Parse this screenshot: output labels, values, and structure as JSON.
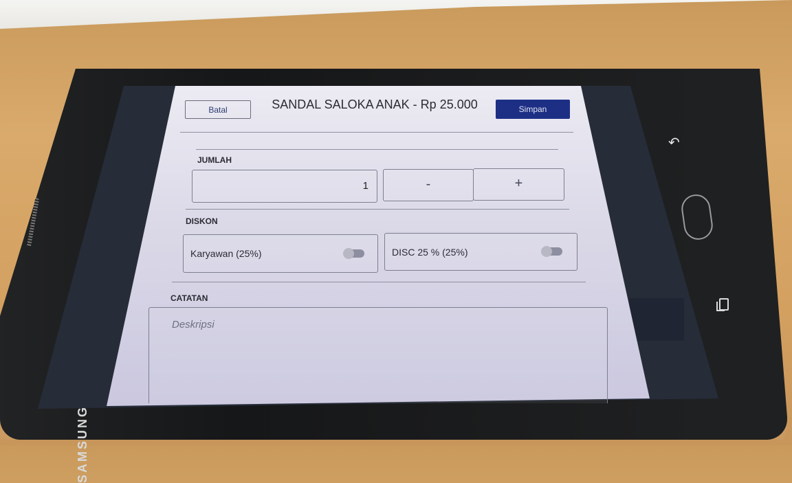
{
  "device": {
    "brand": "SAMSUNG"
  },
  "header": {
    "cancel_label": "Batal",
    "title": "SANDAL SALOKA ANAK - Rp 25.000",
    "save_label": "Simpan"
  },
  "quantity": {
    "label": "JUMLAH",
    "value": "1",
    "decrement": "-",
    "increment": "+"
  },
  "discount": {
    "label": "DISKON",
    "options": [
      {
        "label": "Karyawan (25%)",
        "enabled": false
      },
      {
        "label": "DISC 25 % (25%)",
        "enabled": false
      }
    ]
  },
  "notes": {
    "label": "CATATAN",
    "placeholder": "Deskripsi"
  },
  "icons": {
    "back": "back-arrow-icon",
    "home": "home-button",
    "recent": "recent-apps-icon"
  },
  "colors": {
    "primary_button": "#1d2f85",
    "dialog_bg": "#e3e2ee",
    "text": "#2a2b33"
  }
}
